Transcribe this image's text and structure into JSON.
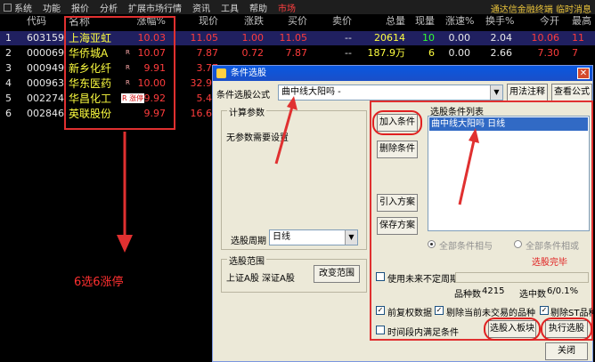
{
  "menubar": {
    "items": [
      "系统",
      "功能",
      "报价",
      "分析",
      "扩展市场行情",
      "资讯",
      "工具",
      "帮助"
    ],
    "active": "市场",
    "right_text": "通达信金融终端 临时消息"
  },
  "table": {
    "headers": [
      "",
      "代码",
      "名称",
      "涨幅%",
      "现价",
      "涨跌",
      "买价",
      "卖价",
      "总量",
      "现量",
      "涨速%",
      "换手%",
      "今开",
      "最高"
    ],
    "rows": [
      {
        "idx": "1",
        "code": "603159",
        "name": "上海亚虹",
        "tag": "",
        "limit": "",
        "pct": "10.03",
        "now": "11.05",
        "chg": "1.00",
        "buy": "11.05",
        "sell": "--",
        "vol": "20614",
        "cur": "10",
        "spd": "0.00",
        "turn": "2.04",
        "open": "10.06",
        "last": "11"
      },
      {
        "idx": "2",
        "code": "000069",
        "name": "华侨城A",
        "tag": "R",
        "limit": "",
        "pct": "10.07",
        "now": "7.87",
        "chg": "0.72",
        "buy": "7.87",
        "sell": "--",
        "vol": "187.9万",
        "cur": "6",
        "spd": "0.00",
        "turn": "2.66",
        "open": "7.30",
        "last": "7"
      },
      {
        "idx": "3",
        "code": "000949",
        "name": "新乡化纤",
        "tag": "R",
        "limit": "",
        "pct": "9.91",
        "now": "3.77",
        "chg": "",
        "buy": "",
        "sell": "",
        "vol": "",
        "cur": "",
        "spd": "",
        "turn": "",
        "open": "",
        "last": ""
      },
      {
        "idx": "4",
        "code": "000963",
        "name": "华东医药",
        "tag": "R",
        "limit": "",
        "pct": "10.00",
        "now": "32.90",
        "chg": "",
        "buy": "",
        "sell": "",
        "vol": "",
        "cur": "",
        "spd": "",
        "turn": "",
        "open": "",
        "last": ""
      },
      {
        "idx": "5",
        "code": "002274",
        "name": "华昌化工",
        "tag": "",
        "limit": "R 涨停",
        "pct": "9.92",
        "now": "5.43",
        "chg": "",
        "buy": "",
        "sell": "",
        "vol": "",
        "cur": "",
        "spd": "",
        "turn": "",
        "open": "",
        "last": ""
      },
      {
        "idx": "6",
        "code": "002846",
        "name": "英联股份",
        "tag": "",
        "limit": "",
        "pct": "9.97",
        "now": "16.65",
        "chg": "",
        "buy": "",
        "sell": "",
        "vol": "",
        "cur": "",
        "spd": "",
        "turn": "",
        "open": "",
        "last": ""
      }
    ]
  },
  "annotation": {
    "caption": "6选6涨停"
  },
  "dialog": {
    "title": "条件选股",
    "formula_label": "条件选股公式",
    "formula_value": "曲中线大阳吗 -",
    "btn_usage": "用法注释",
    "btn_view": "查看公式",
    "params_title": "计算参数",
    "params_text": "无参数需要设置",
    "period_label": "选股周期",
    "period_value": "日线",
    "range_title": "选股范围",
    "range_value": "上证A股 深证A股",
    "btn_change_range": "改变范围",
    "btn_add": "加入条件",
    "btn_delete": "删除条件",
    "btn_import": "引入方案",
    "btn_save": "保存方案",
    "list_title": "选股条件列表",
    "list_item": "曲中线大阳吗   日线",
    "radio_and": "全部条件相与",
    "radio_or": "全部条件相或",
    "select_done": "选股完毕",
    "chk_uncertain": "使用未来不定周期",
    "count_label": "品种数",
    "count_value": "4215",
    "hit_label": "选中数",
    "hit_value": "6/0.1%",
    "chk_pre_rights": "前复权数据",
    "chk_remove_suspended": "剔除当前未交易的品种",
    "chk_remove_st": "剔除ST品种",
    "chk_time_range": "时间段内满足条件",
    "btn_to_block": "选股入板块",
    "btn_execute": "执行选股",
    "btn_close": "关闭"
  }
}
